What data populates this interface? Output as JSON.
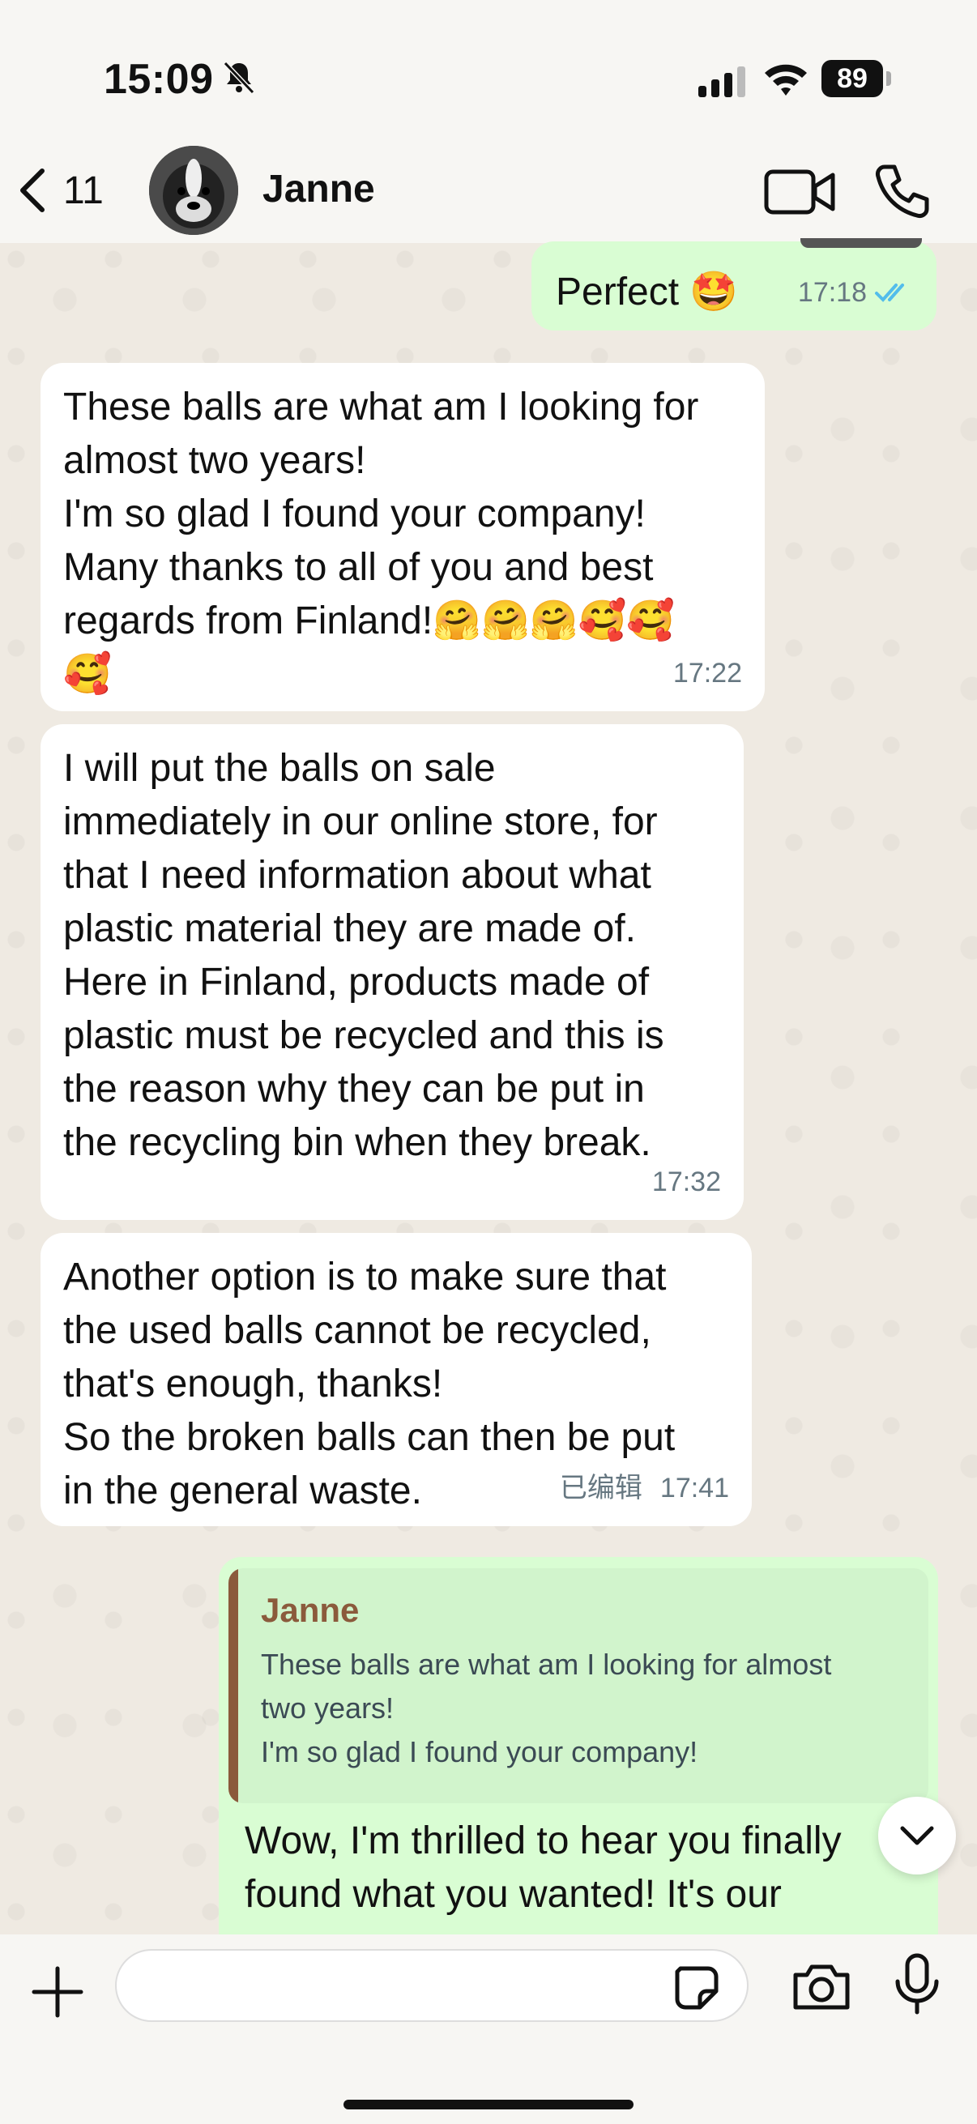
{
  "status_bar": {
    "time": "15:09",
    "battery": "89"
  },
  "header": {
    "back_count": "11",
    "contact_name": "Janne"
  },
  "messages": [
    {
      "id": "m0",
      "direction": "out",
      "text": "Perfect 🤩",
      "time": "17:18"
    },
    {
      "id": "m1",
      "direction": "in",
      "text": "These balls are what am I looking for\nalmost two years!\nI'm so glad I found your company!\nMany thanks to all of you and best\nregards from Finland!🤗🤗🤗🥰🥰\n🥰",
      "time": "17:22"
    },
    {
      "id": "m2",
      "direction": "in",
      "text": "I will put the balls on sale\nimmediately in our online store, for\nthat I need information about what\nplastic material they are made of.\nHere in Finland, products made of\nplastic must be recycled and this is\nthe reason why they can be put in\nthe recycling bin when they break.",
      "time": "17:32"
    },
    {
      "id": "m3",
      "direction": "in",
      "text": "Another option is to make sure that\nthe used balls cannot be recycled,\nthat's enough, thanks!\nSo the broken balls can then be put\nin the general waste.",
      "edited": "已编辑",
      "time": "17:41"
    }
  ],
  "reply": {
    "quoted_name": "Janne",
    "quoted_text": "These balls are what am I looking for almost\ntwo years!\nI'm so glad I found your company!",
    "text": "Wow, I'm thrilled to hear you finally\nfound what you wanted! It's our"
  },
  "composer": {
    "placeholder": ""
  },
  "colors": {
    "incoming": "#ffffff",
    "outgoing": "#d9fdd3",
    "tick_blue": "#53bdeb",
    "quote_accent": "#8b5a3c"
  }
}
